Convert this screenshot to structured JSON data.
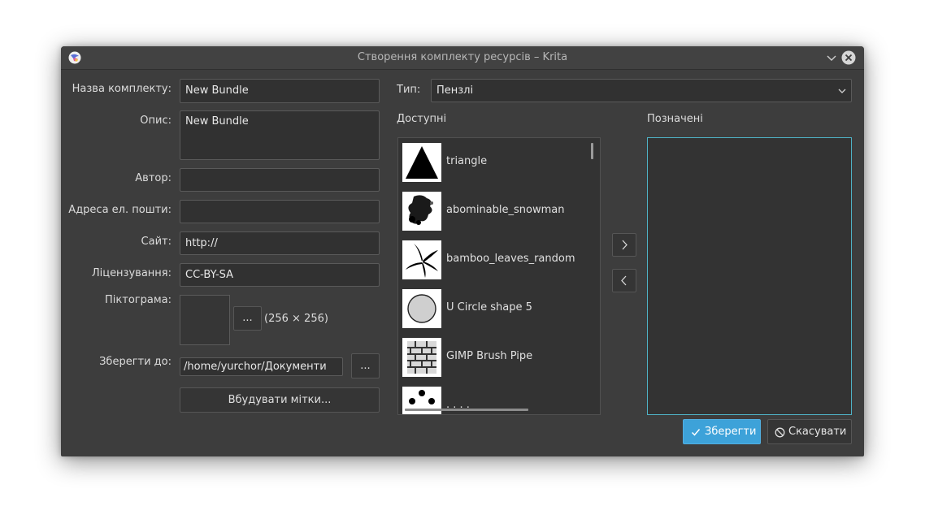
{
  "window": {
    "title": "Створення комплекту ресурсів – Krita"
  },
  "form": {
    "bundle_name_label": "Назва комплекту:",
    "bundle_name_value": "New Bundle",
    "description_label": "Опис:",
    "description_value": "New Bundle",
    "author_label": "Автор:",
    "author_value": "",
    "email_label": "Адреса ел. пошти:",
    "email_value": "",
    "website_label": "Сайт:",
    "website_value": "http://",
    "license_label": "Ліцензування:",
    "license_value": "CC-BY-SA",
    "icon_label": "Піктограма:",
    "icon_browse_label": "...",
    "icon_size_text": "(256 × 256)",
    "save_to_label": "Зберегти до:",
    "save_to_value": "/home/yurchor/Документи",
    "save_to_browse_label": "...",
    "embed_tags_label": "Вбудувати мітки..."
  },
  "resources": {
    "type_label": "Тип:",
    "type_value": "Пензлі",
    "available_label": "Доступні",
    "selected_label": "Позначені",
    "available_items": [
      {
        "name": "triangle"
      },
      {
        "name": "abominable_snowman"
      },
      {
        "name": "bamboo_leaves_random"
      },
      {
        "name": "U Circle shape 5"
      },
      {
        "name": "GIMP Brush Pipe"
      },
      {
        "name": ". . . ."
      }
    ],
    "selected_items": []
  },
  "buttons": {
    "save_label": "Зберегти",
    "cancel_label": "Скасувати"
  },
  "colors": {
    "window_bg": "#3d3d3d",
    "accent": "#3da2d9",
    "selected_list_border": "#4fb3c7"
  },
  "icons": {
    "app": "krita-icon",
    "minimize": "chevron-down-icon",
    "close": "close-icon",
    "move_right": "chevron-right-icon",
    "move_left": "chevron-left-icon",
    "save": "check-icon",
    "cancel": "cancel-icon"
  }
}
